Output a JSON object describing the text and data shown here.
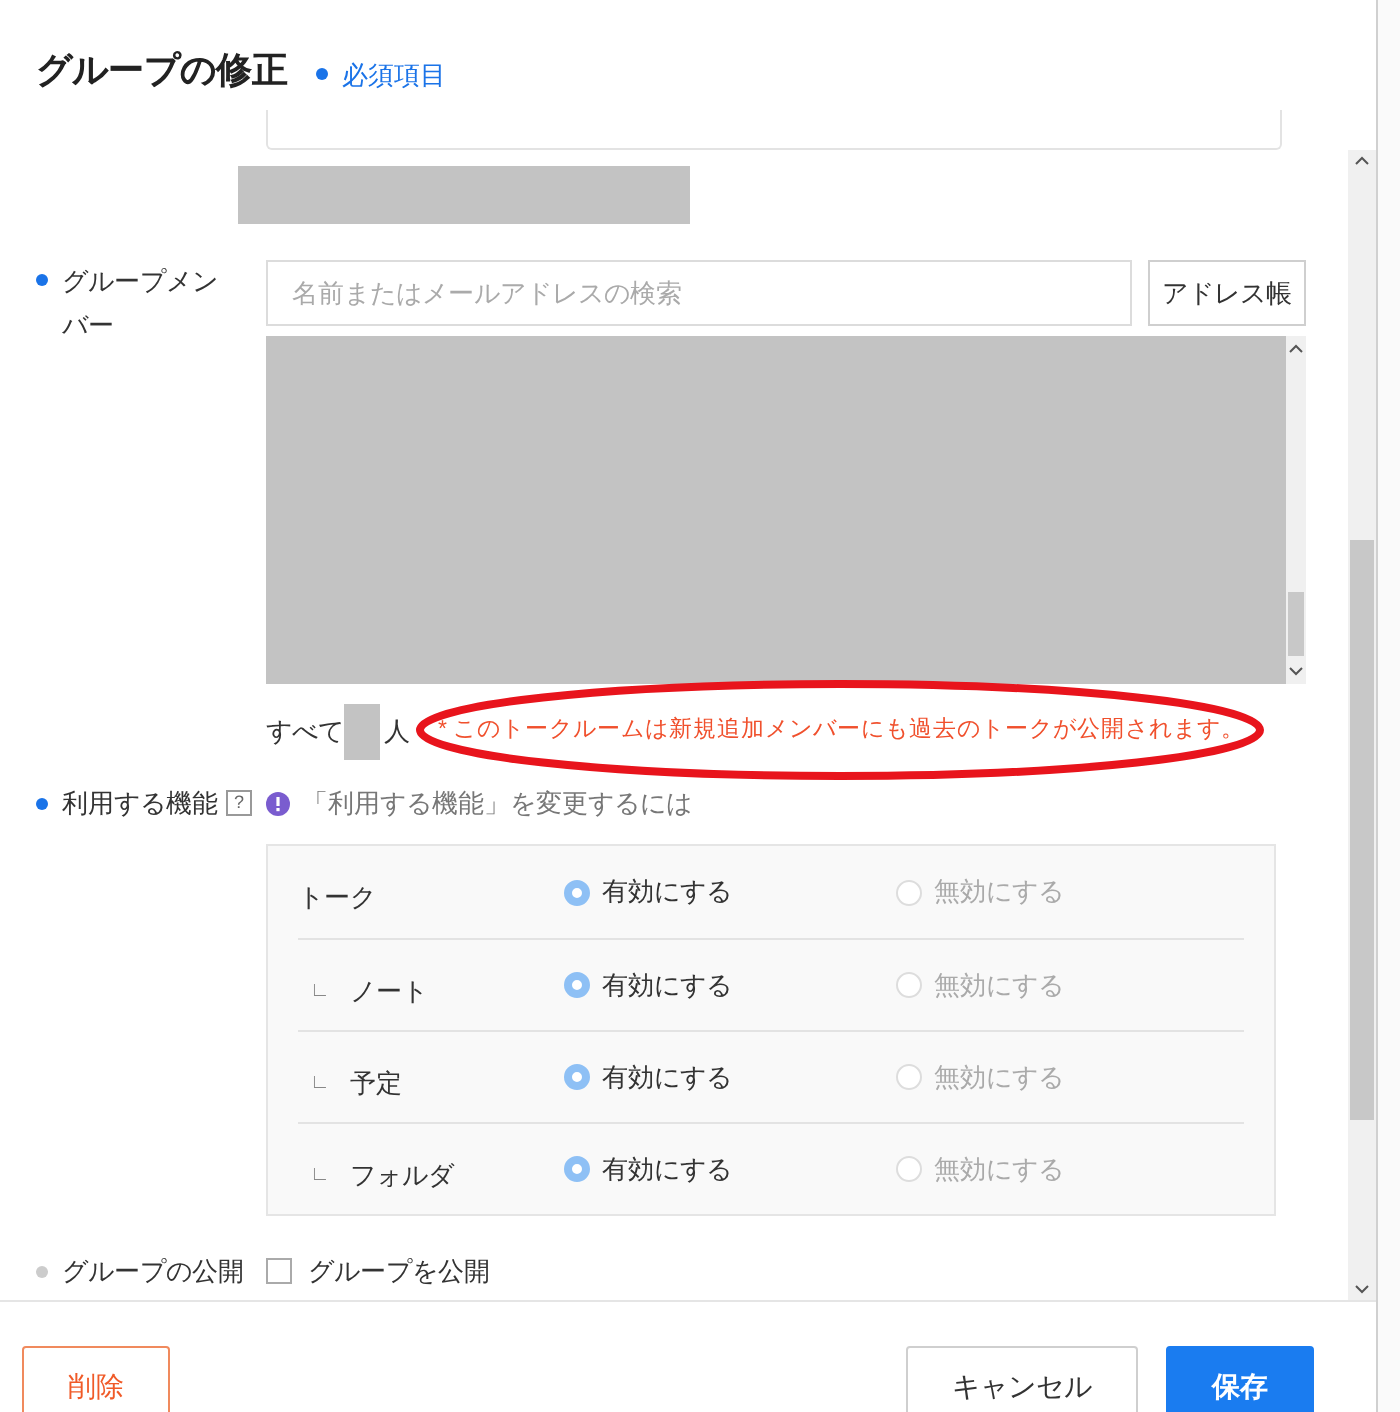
{
  "dialog": {
    "title": "グループの修正",
    "required_note": "必須項目"
  },
  "members": {
    "label": "グループメンバー",
    "required": true,
    "search": {
      "placeholder": "名前またはメールアドレスの検索"
    },
    "address_book_button": "アドレス帳",
    "total_prefix": "すべて",
    "total_suffix": "人",
    "notice": "* このトークルームは新規追加メンバーにも過去のトークが公開されます。"
  },
  "features": {
    "label": "利用する機能",
    "required": true,
    "help": "?",
    "info_link": "「利用する機能」を変更するには",
    "rows": [
      {
        "name": "トーク",
        "options": [
          {
            "label": "有効にする",
            "selected": true
          },
          {
            "label": "無効にする",
            "selected": false
          }
        ]
      },
      {
        "prefix": "∟",
        "name": "ノート",
        "options": [
          {
            "label": "有効にする",
            "selected": true
          },
          {
            "label": "無効にする",
            "selected": false
          }
        ]
      },
      {
        "prefix": "∟",
        "name": "予定",
        "options": [
          {
            "label": "有効にする",
            "selected": true
          },
          {
            "label": "無効にする",
            "selected": false
          }
        ]
      },
      {
        "prefix": "∟",
        "name": "フォルダ",
        "options": [
          {
            "label": "有効にする",
            "selected": true
          },
          {
            "label": "無効にする",
            "selected": false
          }
        ]
      }
    ]
  },
  "publish": {
    "label": "グループの公開",
    "required": false,
    "checkbox": {
      "label": "グループを公開",
      "checked": false
    }
  },
  "buttons": [
    {
      "label": "削除",
      "kind": "danger"
    },
    {
      "label": "キャンセル",
      "kind": "secondary"
    },
    {
      "label": "保存",
      "kind": "primary"
    }
  ]
}
